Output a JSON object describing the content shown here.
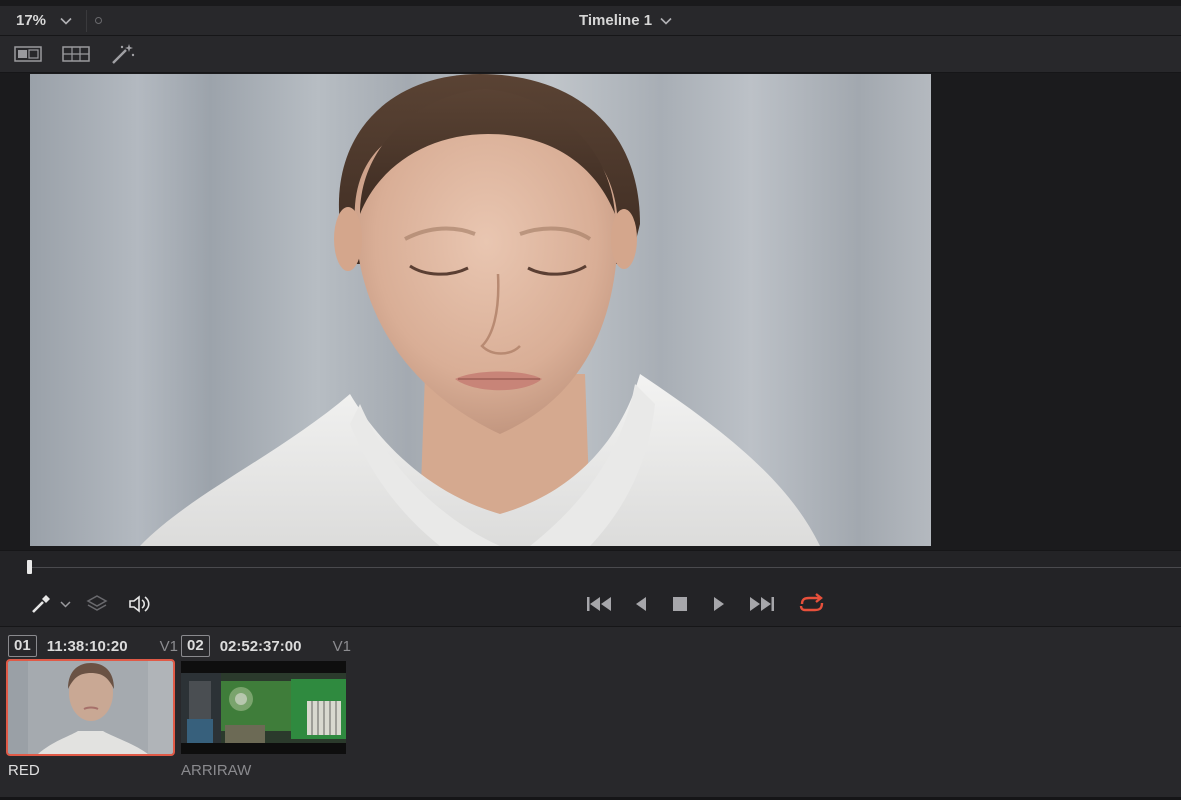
{
  "viewer": {
    "zoom_level": "17%",
    "timeline_name": "Timeline 1"
  },
  "toolbar": {
    "icons": [
      "single-viewer-icon",
      "split-viewer-icon",
      "magic-wand-icon"
    ]
  },
  "transport": {
    "playhead_position": 0,
    "icons": [
      "eyedropper-icon",
      "layers-icon",
      "speaker-icon",
      "go-to-start-icon",
      "step-back-icon",
      "stop-icon",
      "play-icon",
      "go-to-end-icon",
      "loop-icon"
    ],
    "loop_color": "#e8503b"
  },
  "clips": [
    {
      "number": "01",
      "timecode": "11:38:10:20",
      "track": "V1",
      "name": "RED",
      "selected": true
    },
    {
      "number": "02",
      "timecode": "02:52:37:00",
      "track": "V1",
      "name": "ARRIRAW",
      "selected": false
    }
  ],
  "colors": {
    "selection": "#e05a47",
    "panel": "#28282b",
    "background": "#1c1c1e"
  }
}
